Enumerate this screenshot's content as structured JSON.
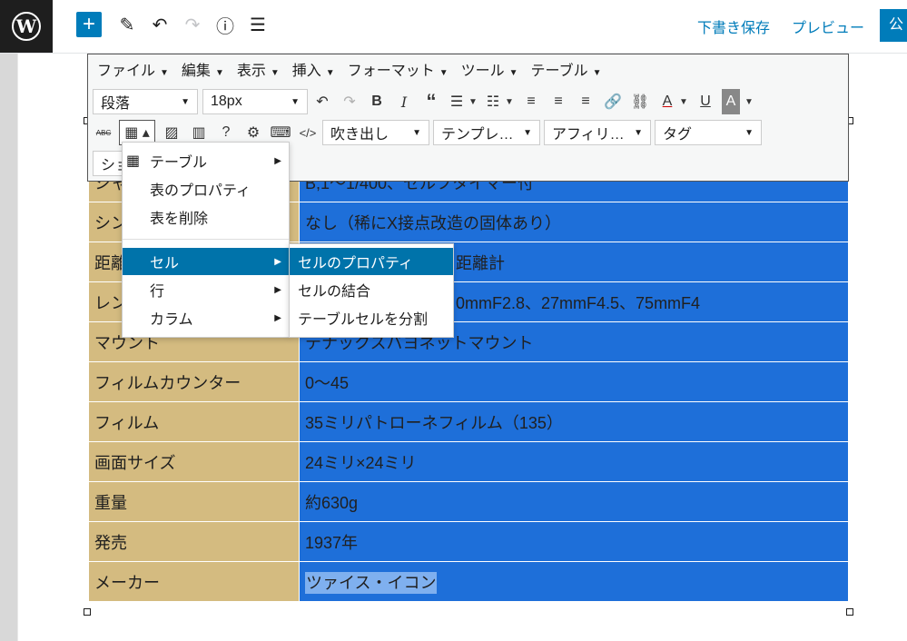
{
  "topbar": {
    "save_draft": "下書き保存",
    "preview": "プレビュー",
    "publish": "公"
  },
  "menubar": [
    {
      "label": "ファイル"
    },
    {
      "label": "編集"
    },
    {
      "label": "表示"
    },
    {
      "label": "挿入"
    },
    {
      "label": "フォーマット"
    },
    {
      "label": "ツール"
    },
    {
      "label": "テーブル"
    }
  ],
  "toolbar": {
    "format_select": "段落",
    "size_select": "18px",
    "balloon_select": "吹き出し",
    "template_select": "テンプレ…",
    "affiliate_select": "アフィリ…",
    "tag_select": "タグ",
    "short_select": "ショ"
  },
  "table_menu": {
    "items": [
      "テーブル",
      "表のプロパティ",
      "表を削除",
      "セル",
      "行",
      "カラム"
    ]
  },
  "cell_submenu": {
    "items": [
      "セルのプロパティ",
      "セルの結合",
      "テーブルセルを分割"
    ]
  },
  "table": {
    "rows": [
      {
        "key": "シャ",
        "value": "B,1～1/400、セルフタイマー付"
      },
      {
        "key": "シン",
        "value": "なし（稀にX接点改造の固体あり）"
      },
      {
        "key": "距離",
        "value": "距離計"
      },
      {
        "key": "レン",
        "value": "0mmF2.8、27mmF4.5、75mmF4"
      },
      {
        "key": "マウント",
        "value": "テナックスバヨネットマウント"
      },
      {
        "key": "フィルムカウンター",
        "value": "0～45"
      },
      {
        "key": "フィルム",
        "value": "35ミリパトローネフィルム（135）"
      },
      {
        "key": "画面サイズ",
        "value": "24ミリ×24ミリ"
      },
      {
        "key": "重量",
        "value": "約630g"
      },
      {
        "key": "発売",
        "value": "1937年"
      },
      {
        "key": "メーカー",
        "value": "ツァイス・イコン"
      }
    ]
  },
  "colors": {
    "accent": "#007cba",
    "key_cell": "#d4bb80",
    "value_cell": "#1e6fd9",
    "menu_highlight": "#0073aa"
  }
}
